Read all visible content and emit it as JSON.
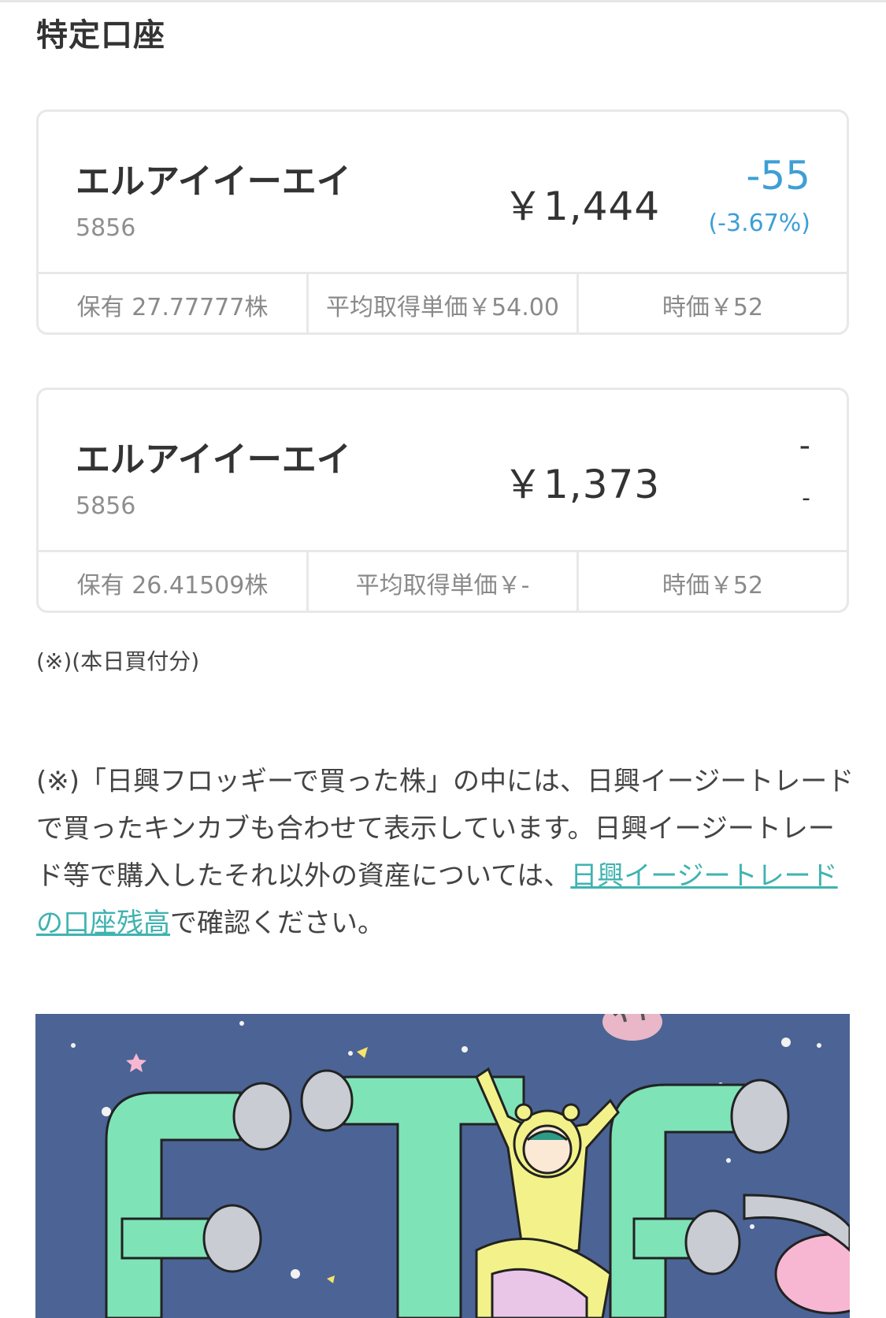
{
  "section": {
    "title": "特定口座"
  },
  "holdings": [
    {
      "name": "エルアイイーエイ",
      "code": "5856",
      "amount": "￥1,444",
      "change": "-55",
      "change_pct": "(-3.67%)",
      "shares": "保有 27.77777株",
      "avg_cost": "平均取得単価￥54.00",
      "market_price": "時価￥52"
    },
    {
      "name": "エルアイイーエイ",
      "code": "5856",
      "amount": "￥1,373",
      "change": "-",
      "change_pct": "-",
      "shares": "保有 26.41509株",
      "avg_cost": "平均取得単価￥-",
      "market_price": "時価￥52"
    }
  ],
  "notes": {
    "small": "(※)(本日買付分)",
    "paragraph_before": "(※)「日興フロッギーで買った株」の中には、日興イージートレードで買ったキンカブも合わせて表示しています。日興イージートレード等で購入したそれ以外の資産については、",
    "link": "日興イージートレードの口座残高",
    "paragraph_after": "で確認ください。"
  },
  "colors": {
    "accent_blue": "#3d9fd6",
    "link_teal": "#3fb3b0",
    "banner_bg": "#4b6495",
    "banner_tube": "#7fe3b8"
  },
  "banner": {
    "icon": "etf-illustration"
  }
}
